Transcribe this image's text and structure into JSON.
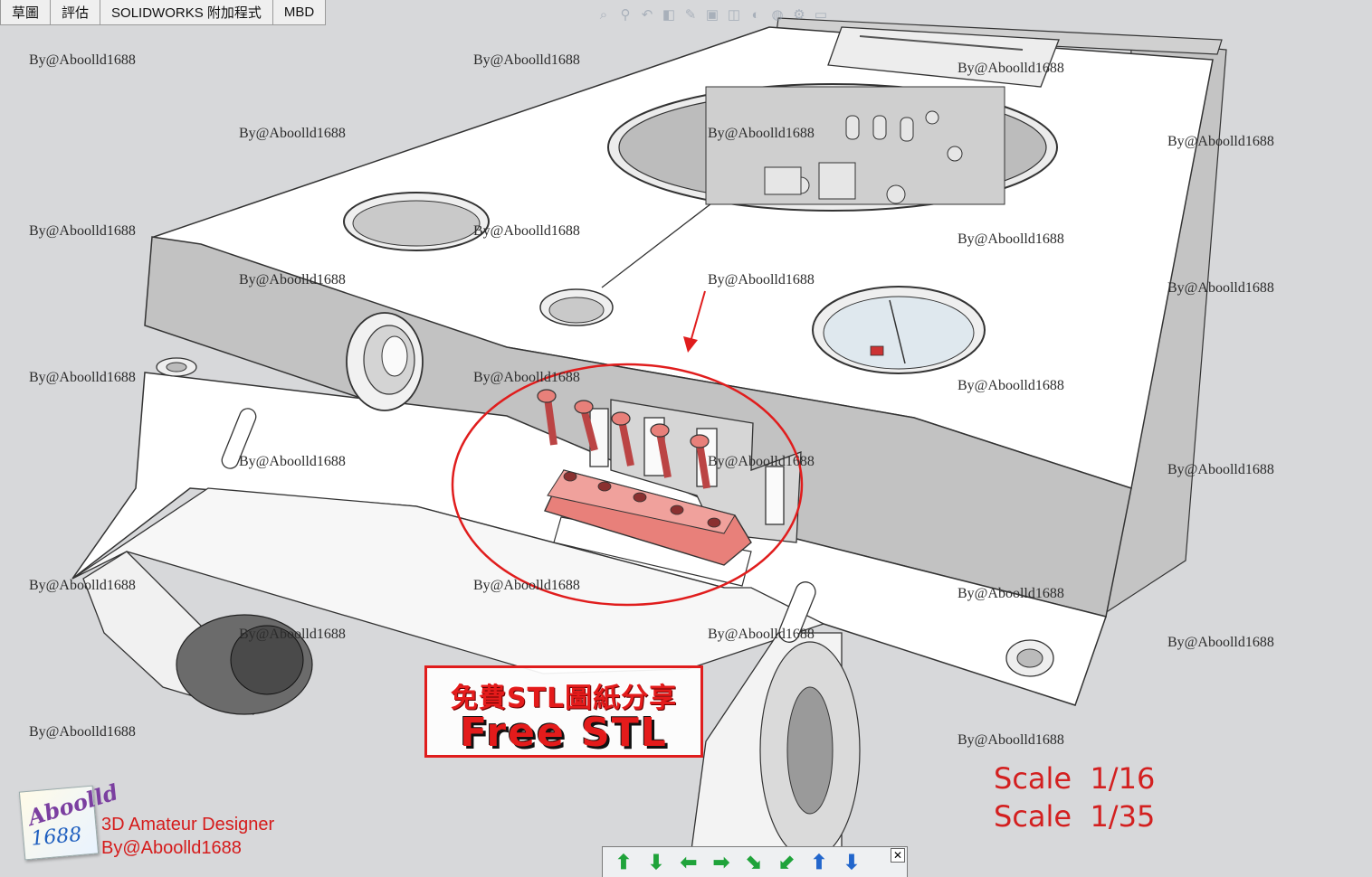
{
  "tabs": [
    "草圖",
    "評估",
    "SOLIDWORKS 附加程式",
    "MBD"
  ],
  "hud_icons": [
    "zoom-to-fit-icon",
    "zoom-area-icon",
    "previous-view-icon",
    "section-view-icon",
    "view-orientation-icon",
    "display-style-icon",
    "hide-show-icon",
    "edit-appearance-icon",
    "apply-scene-icon",
    "view-settings-icon",
    "display-pane-icon"
  ],
  "watermark_text": "By@Aboolld1688",
  "banner": {
    "line1": "免費STL圖紙分享",
    "line2": "Free STL"
  },
  "scale": {
    "line1": "Scale  1/16",
    "line2": "Scale  1/35"
  },
  "logo": {
    "line1": "Aboolld",
    "line2": "1688"
  },
  "designer": {
    "line1": "3D Amateur Designer",
    "line2": "By@Aboolld1688"
  },
  "nav_buttons": [
    {
      "name": "rotate-up-icon",
      "glyph": "⬆",
      "color": "#1fa33a"
    },
    {
      "name": "rotate-down-icon",
      "glyph": "⬇",
      "color": "#1fa33a"
    },
    {
      "name": "rotate-left-icon",
      "glyph": "⬅",
      "color": "#1fa33a"
    },
    {
      "name": "rotate-right-icon",
      "glyph": "➡",
      "color": "#1fa33a"
    },
    {
      "name": "roll-clockwise-icon",
      "glyph": "⬊",
      "color": "#1fa33a"
    },
    {
      "name": "roll-counterclockwise-icon",
      "glyph": "⬋",
      "color": "#1fa33a"
    },
    {
      "name": "pan-up-icon",
      "glyph": "⬆",
      "color": "#2266cc"
    },
    {
      "name": "pan-down-icon",
      "glyph": "⬇",
      "color": "#2266cc"
    }
  ],
  "colors": {
    "accent_red": "#e01d1d",
    "highlight_part": "#e8807a",
    "model_face": "#ffffff",
    "model_side": "#bdbdbd",
    "background": "#d7d8da"
  }
}
